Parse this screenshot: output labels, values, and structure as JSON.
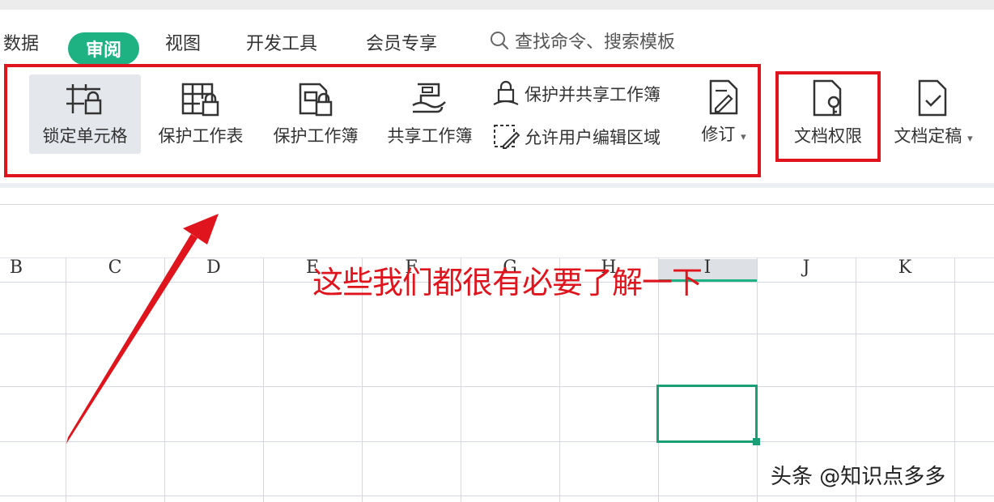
{
  "menu": {
    "items": [
      "数据",
      "视图",
      "开发工具",
      "会员专享"
    ],
    "active": "审阅",
    "search_placeholder": "查找命令、搜索模板"
  },
  "ribbon": {
    "lock_cell": "锁定单元格",
    "protect_sheet": "保护工作表",
    "protect_book": "保护工作簿",
    "share_book": "共享工作簿",
    "protect_share": "保护并共享工作簿",
    "allow_edit": "允许用户编辑区域",
    "revise": "修订",
    "doc_permission": "文档权限",
    "doc_finalize": "文档定稿"
  },
  "columns": [
    "B",
    "C",
    "D",
    "E",
    "F",
    "G",
    "H",
    "I",
    "J",
    "K"
  ],
  "annotation": "这些我们都很有必要了解一下",
  "watermark": "头条 @知识点多多",
  "colors": {
    "accent": "#1eb283",
    "annotation_red": "#e0141c"
  }
}
